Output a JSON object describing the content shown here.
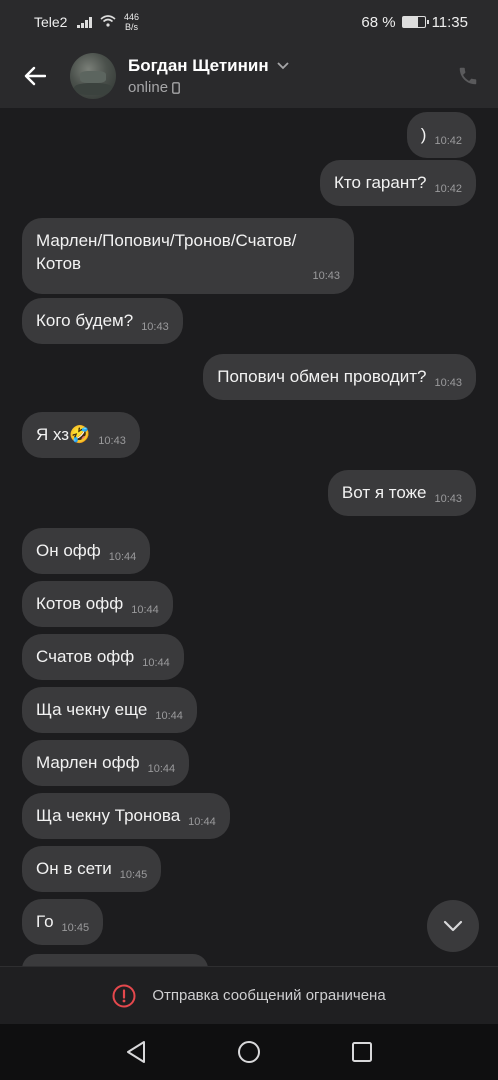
{
  "status_bar": {
    "carrier": "Tele2",
    "speed_value": "446",
    "speed_unit": "B/s",
    "battery": "68 %",
    "battery_level": 0.68,
    "time": "11:35"
  },
  "header": {
    "name": "Богдан Щетинин",
    "status": "online"
  },
  "messages": [
    {
      "dir": "out",
      "text": ")",
      "time": "10:42"
    },
    {
      "dir": "out",
      "text": "Кто гарант?",
      "time": "10:42"
    },
    {
      "dir": "in",
      "text": "Марлен/Попович/Тронов/Счатов/Котов",
      "time": "10:43"
    },
    {
      "dir": "in",
      "text": "Кого будем?",
      "time": "10:43"
    },
    {
      "dir": "out",
      "text": "Попович обмен проводит?",
      "time": "10:43"
    },
    {
      "dir": "in",
      "text": "Я хз🤣",
      "time": "10:43"
    },
    {
      "dir": "out",
      "text": "Вот я тоже",
      "time": "10:43"
    },
    {
      "dir": "in",
      "text": "Он офф",
      "time": "10:44"
    },
    {
      "dir": "in",
      "text": "Котов офф",
      "time": "10:44"
    },
    {
      "dir": "in",
      "text": "Счатов офф",
      "time": "10:44"
    },
    {
      "dir": "in",
      "text": "Ща чекну еще",
      "time": "10:44"
    },
    {
      "dir": "in",
      "text": "Марлен офф",
      "time": "10:44"
    },
    {
      "dir": "in",
      "text": "Ща чекну Тронова",
      "time": "10:44"
    },
    {
      "dir": "in",
      "text": "Он в сети",
      "time": "10:45"
    },
    {
      "dir": "in",
      "text": "Го",
      "time": "10:45"
    }
  ],
  "restriction": {
    "text": "Отправка сообщений ограничена"
  },
  "colors": {
    "background": "#1c1c1e",
    "bubble": "#3a3a3c",
    "header": "#2a2a2c",
    "warning": "#e5484d"
  }
}
